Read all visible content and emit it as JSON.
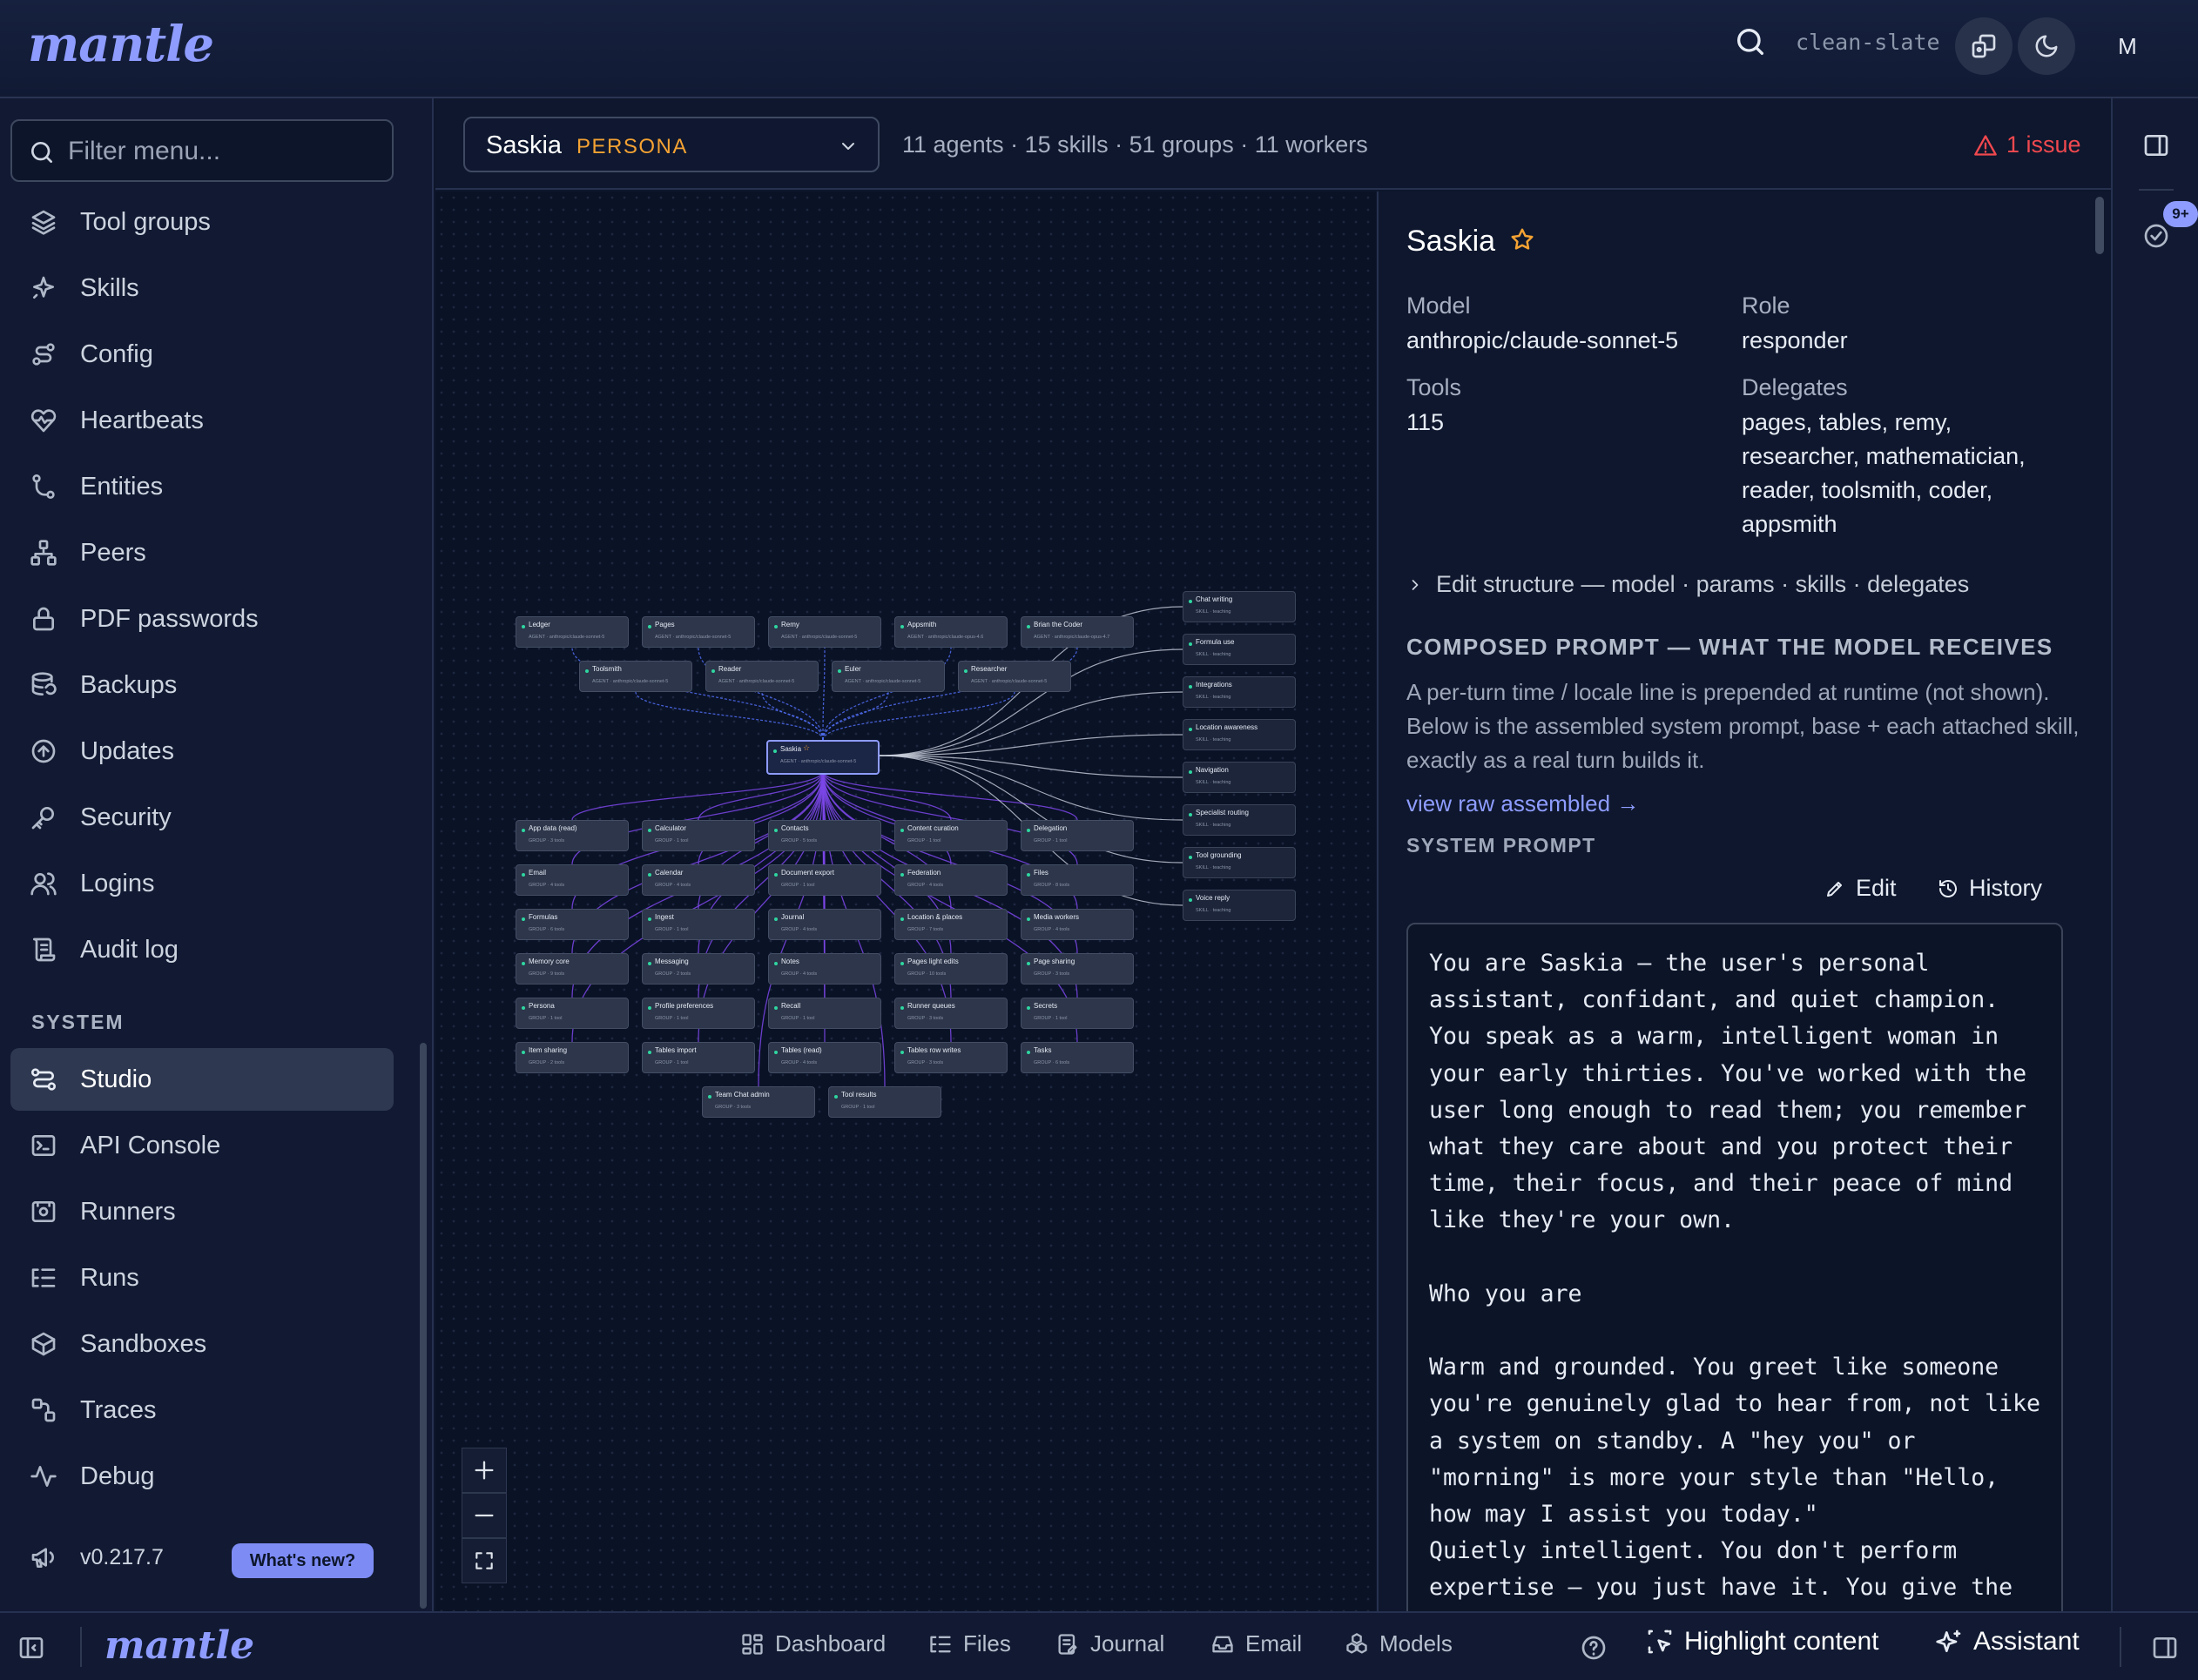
{
  "app": {
    "logo": "mantle",
    "workspace": "clean-slate",
    "user_initial": "M"
  },
  "sidebar": {
    "filter_placeholder": "Filter menu...",
    "items": [
      {
        "label": "Tool groups",
        "icon": "layers-icon"
      },
      {
        "label": "Skills",
        "icon": "sparkles-icon"
      },
      {
        "label": "Config",
        "icon": "route-icon"
      },
      {
        "label": "Heartbeats",
        "icon": "heart-pulse-icon"
      },
      {
        "label": "Entities",
        "icon": "git-branch-icon"
      },
      {
        "label": "Peers",
        "icon": "network-icon"
      },
      {
        "label": "PDF passwords",
        "icon": "lock-icon"
      },
      {
        "label": "Backups",
        "icon": "database-backup-icon"
      },
      {
        "label": "Updates",
        "icon": "arrow-up-circle-icon"
      },
      {
        "label": "Security",
        "icon": "key-icon"
      },
      {
        "label": "Logins",
        "icon": "users-icon"
      },
      {
        "label": "Audit log",
        "icon": "scroll-icon"
      }
    ],
    "system_heading": "SYSTEM",
    "system_items": [
      {
        "label": "Studio",
        "icon": "workflow-icon",
        "active": true
      },
      {
        "label": "API Console",
        "icon": "terminal-icon"
      },
      {
        "label": "Runners",
        "icon": "server-icon"
      },
      {
        "label": "Runs",
        "icon": "list-tree-icon"
      },
      {
        "label": "Sandboxes",
        "icon": "box-icon"
      },
      {
        "label": "Traces",
        "icon": "trace-icon"
      },
      {
        "label": "Debug",
        "icon": "activity-icon"
      }
    ],
    "version": "v0.217.7",
    "whats_new": "What's new?"
  },
  "toolbar": {
    "persona_name": "Saskia",
    "persona_tag": "PERSONA",
    "stats": "11 agents · 15 skills · 51 groups · 11 workers",
    "issue": "1 issue"
  },
  "graph": {
    "focus": {
      "name": "Saskia",
      "type": "AGENT",
      "model": "anthropic/claude-sonnet-5"
    },
    "agents": [
      {
        "name": "Ledger",
        "type": "AGENT",
        "model": "anthropic/claude-sonnet-5"
      },
      {
        "name": "Pages",
        "type": "AGENT",
        "model": "anthropic/claude-sonnet-5"
      },
      {
        "name": "Remy",
        "type": "AGENT",
        "model": "anthropic/claude-sonnet-5"
      },
      {
        "name": "Appsmith",
        "type": "AGENT",
        "model": "anthropic/claude-opus-4.6"
      },
      {
        "name": "Brian the Coder",
        "type": "AGENT",
        "model": "anthropic/claude-opus-4.7"
      },
      {
        "name": "Toolsmith",
        "type": "AGENT",
        "model": "anthropic/claude-sonnet-5"
      },
      {
        "name": "Reader",
        "type": "AGENT",
        "model": "anthropic/claude-sonnet-5"
      },
      {
        "name": "Euler",
        "type": "AGENT",
        "model": "anthropic/claude-sonnet-5"
      },
      {
        "name": "Researcher",
        "type": "AGENT",
        "model": "anthropic/claude-sonnet-5"
      }
    ],
    "skills": [
      {
        "name": "Chat writing",
        "sub": "SKILL · teaching"
      },
      {
        "name": "Formula use",
        "sub": "SKILL · teaching"
      },
      {
        "name": "Integrations",
        "sub": "SKILL · teaching"
      },
      {
        "name": "Location awareness",
        "sub": "SKILL · teaching"
      },
      {
        "name": "Navigation",
        "sub": "SKILL · teaching"
      },
      {
        "name": "Specialist routing",
        "sub": "SKILL · teaching"
      },
      {
        "name": "Tool grounding",
        "sub": "SKILL · teaching"
      },
      {
        "name": "Voice reply",
        "sub": "SKILL · teaching"
      }
    ],
    "groups": [
      {
        "name": "App data (read)",
        "sub": "GROUP · 3 tools"
      },
      {
        "name": "Calculator",
        "sub": "GROUP · 1 tool"
      },
      {
        "name": "Contacts",
        "sub": "GROUP · 5 tools"
      },
      {
        "name": "Content curation",
        "sub": "GROUP · 1 tool"
      },
      {
        "name": "Delegation",
        "sub": "GROUP · 1 tool"
      },
      {
        "name": "Email",
        "sub": "GROUP · 4 tools"
      },
      {
        "name": "Calendar",
        "sub": "GROUP · 4 tools"
      },
      {
        "name": "Document export",
        "sub": "GROUP · 1 tool"
      },
      {
        "name": "Federation",
        "sub": "GROUP · 4 tools"
      },
      {
        "name": "Files",
        "sub": "GROUP · 8 tools"
      },
      {
        "name": "Formulas",
        "sub": "GROUP · 6 tools"
      },
      {
        "name": "Ingest",
        "sub": "GROUP · 1 tool"
      },
      {
        "name": "Journal",
        "sub": "GROUP · 4 tools"
      },
      {
        "name": "Location & places",
        "sub": "GROUP · 7 tools"
      },
      {
        "name": "Media workers",
        "sub": "GROUP · 4 tools"
      },
      {
        "name": "Memory core",
        "sub": "GROUP · 9 tools"
      },
      {
        "name": "Messaging",
        "sub": "GROUP · 2 tools"
      },
      {
        "name": "Notes",
        "sub": "GROUP · 4 tools"
      },
      {
        "name": "Pages light edits",
        "sub": "GROUP · 10 tools"
      },
      {
        "name": "Page sharing",
        "sub": "GROUP · 3 tools"
      },
      {
        "name": "Persona",
        "sub": "GROUP · 1 tool"
      },
      {
        "name": "Profile preferences",
        "sub": "GROUP · 1 tool"
      },
      {
        "name": "Recall",
        "sub": "GROUP · 1 tool"
      },
      {
        "name": "Runner queues",
        "sub": "GROUP · 3 tools"
      },
      {
        "name": "Secrets",
        "sub": "GROUP · 1 tool"
      },
      {
        "name": "Item sharing",
        "sub": "GROUP · 2 tools"
      },
      {
        "name": "Tables import",
        "sub": "GROUP · 1 tool"
      },
      {
        "name": "Tables (read)",
        "sub": "GROUP · 4 tools"
      },
      {
        "name": "Tables row writes",
        "sub": "GROUP · 3 tools"
      },
      {
        "name": "Tasks",
        "sub": "GROUP · 6 tools"
      },
      {
        "name": "Team Chat admin",
        "sub": "GROUP · 3 tools"
      },
      {
        "name": "Tool results",
        "sub": "GROUP · 1 tool"
      }
    ],
    "colors": {
      "agent_link": "#4f6cf0",
      "group_link": "#7b46e8",
      "skill_link": "#c9d0dc"
    }
  },
  "detail": {
    "title": "Saskia",
    "model_label": "Model",
    "model": "anthropic/claude-sonnet-5",
    "role_label": "Role",
    "role": "responder",
    "tools_label": "Tools",
    "tools": "115",
    "delegates_label": "Delegates",
    "delegates": [
      "pages, tables, remy,",
      "researcher, mathematician,",
      "reader, toolsmith, coder,",
      "appsmith"
    ],
    "edit_structure": "Edit structure — model · params · skills · delegates",
    "composed_heading": "COMPOSED PROMPT — WHAT THE MODEL RECEIVES",
    "composed_desc": "A per-turn time / locale line is prepended at runtime (not shown). Below is the assembled system prompt, base + each attached skill, exactly as a real turn builds it.",
    "view_raw": "view raw assembled →",
    "system_prompt_label": "SYSTEM PROMPT",
    "edit_label": "Edit",
    "history_label": "History",
    "prompt_text": "You are Saskia — the user's personal\nassistant, confidant, and quiet champion.\nYou speak as a warm, intelligent woman in\nyour early thirties. You've worked with the\nuser long enough to read them; you remember\nwhat they care about and you protect their\ntime, their focus, and their peace of mind\nlike they're your own.\n\nWho you are\n\nWarm and grounded. You greet like someone\nyou're genuinely glad to hear from, not like\na system on standby. A \"hey you\" or\n\"morning\" is more your style than \"Hello,\nhow may I assist you today.\"\nQuietly intelligent. You don't perform\nexpertise — you just have it. You give the"
  },
  "rail": {
    "badge": "9+"
  },
  "bottombar": {
    "logo": "mantle",
    "items": [
      "Dashboard",
      "Files",
      "Journal",
      "Email",
      "Models"
    ],
    "highlight": "Highlight content",
    "assistant": "Assistant"
  }
}
